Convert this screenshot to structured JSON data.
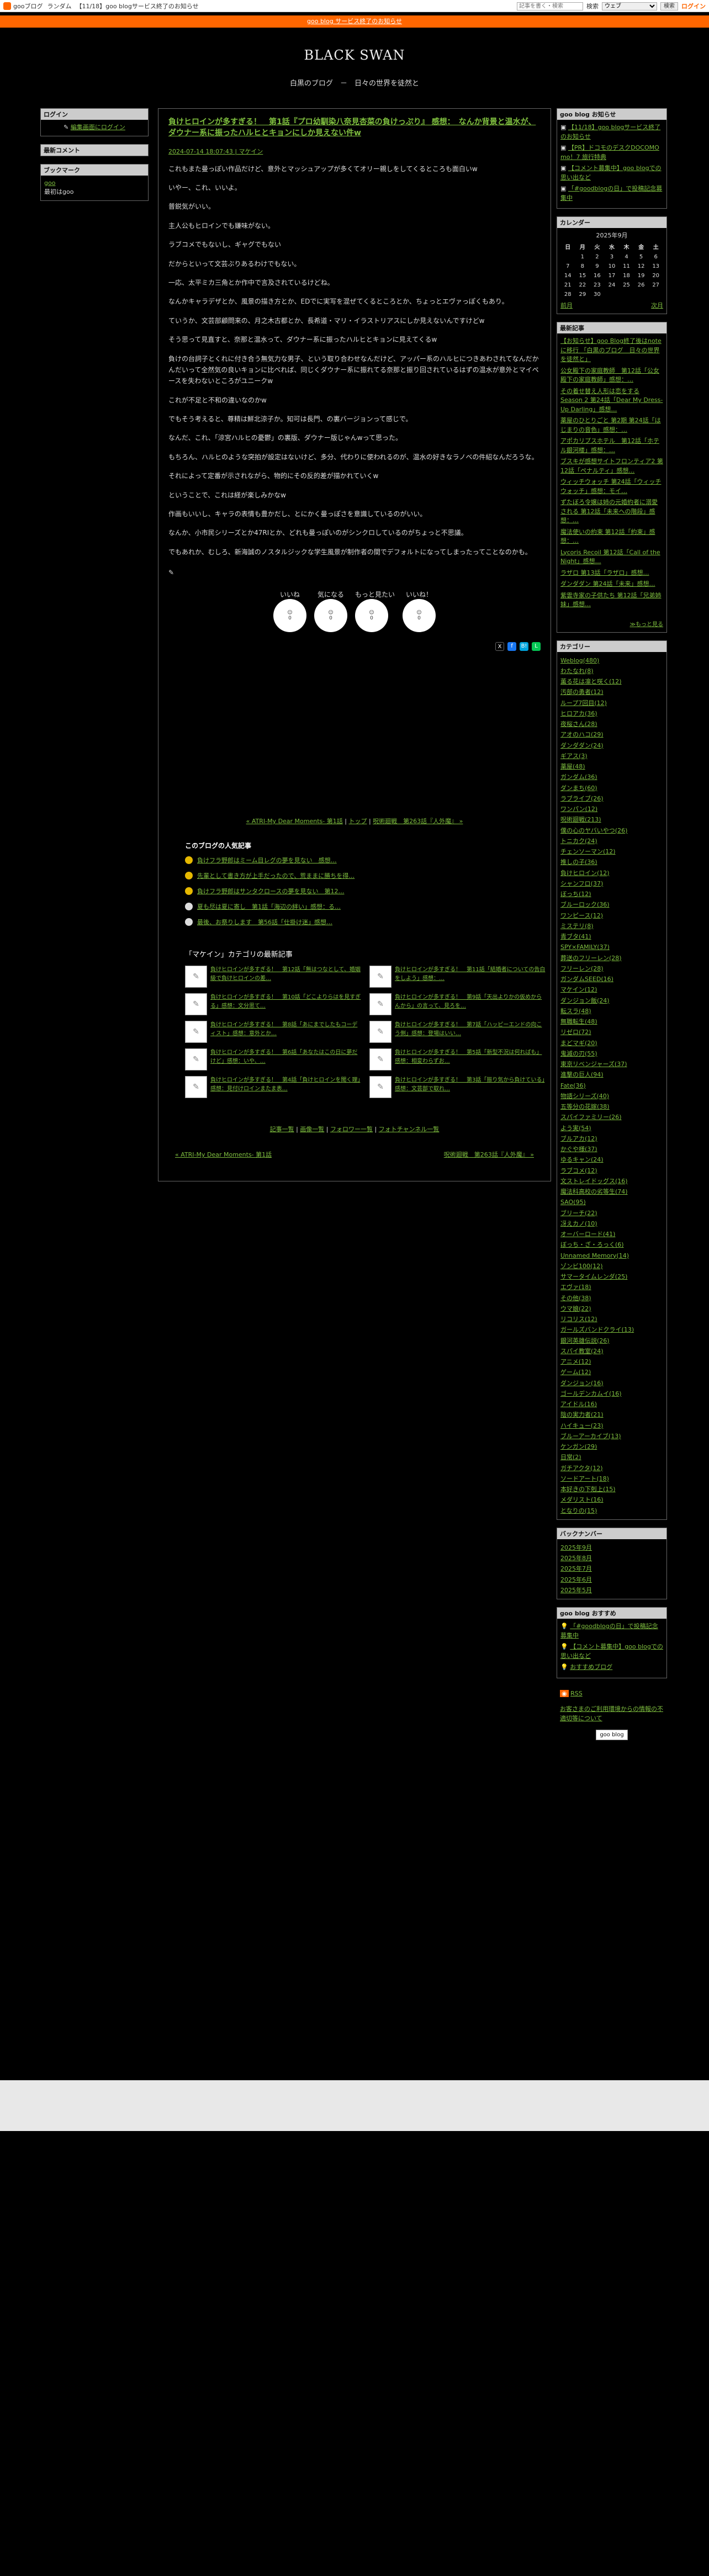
{
  "topbar": {
    "links": [
      "gooブログ",
      "ランダム",
      "【11/18】goo blogサービス終了のお知らせ"
    ],
    "search_placeholder": "記事を書く・検索",
    "search_label": "検索",
    "select_value": "ウェブ",
    "search_button": "検索",
    "login": "ログイン"
  },
  "notice": "goo blog サービス終了のお知らせ",
  "header": {
    "title": "BLACK SWAN",
    "description": "白黒のブログ　－　日々の世界を徒然と"
  },
  "left": {
    "login_head": "ログイン",
    "login_link": "編集画面にログイン",
    "recent_comments_head": "最新コメント",
    "bookmark_head": "ブックマーク",
    "bookmark_link": "goo",
    "bookmark_desc": "最初はgoo"
  },
  "entry": {
    "title": "負けヒロインが多すぎる！　第1話『プロ幼馴染八奈見杏菜の負けっぷり』 感想：　なんか背景と温水が、ダウナー系に振ったハルヒとキョンにしか見えない件w",
    "date": "2024-07-14 18:07:43",
    "category": "マケイン",
    "paragraphs": [
      "これもまた曼っぽい作品だけど、意外とマッシュアップが多くてオリー親しをしてくるところも面白いw",
      "いやー、これ、いいよ。",
      "普鋭気がいい。",
      "主人公もヒロインでも嫌味がない。",
      "ラブコメでもないし、ギャグでもない",
      "だからといって文芸ぶりあるわけでもない。",
      "一応、太平ミカ三角とか作中で言及されているけどね。",
      "なんかキャラデザとか、風景の描き方とか、EDでに実写を混ぜてくるところとか、ちょっとエヴァっぽくもあり。",
      "ていうか、文芸部顧問来の、月之木古都とか、長希道・マリ・イラストリアスにしか見えないんですけどw",
      "そう思って見直すと、奈那と温水って、ダウナー系に振ったハルヒとキョンに見えてくるw",
      "負けの台詞子とくれに付き合う無気力な男子、という取り合わせなんだけど、アッパー系のハルヒにつきあわされてなんだかんだいって全然気の良いキョンに比べれば、同じくダウナー系に振れてる奈那と振り回されているはずの温水が意外とマイペースを失わないところがユニークw",
      "これが不足と不和の違いなのかw",
      "でもそう考えると、尊精は鮮北涼子か。知可は長門、の裏バージョンって感じで。",
      "なんだ、これ、「涼宮ハルヒの憂鬱」の裏版、ダウナー版じゃんwって思った。",
      "もちろん、ハルヒのような突拍が設定はないけど、多分、代わりに使われるのが、温水の好きなラノベの件紹なんだろうな。",
      "それによって定番が示されながら、物的にその反的差が描かれていくw",
      "ということで、これは経が楽しみかなw",
      "作画もいいし、キャラの表情も豊かだし、とにかく曼っぽさを意識しているのがいい。",
      "なんか、小市民シリーズとか47RIとか、どれも曼っぽいのがシンクロしているのがちょっと不思議。",
      "でもあれか、むしろ、新海誠のノスタルジックな学生風景が制作者の間でデフォルトになってしまったってことなのかも。"
    ],
    "reactions": [
      {
        "label": "いいね",
        "count": "0"
      },
      {
        "label": "気になる",
        "count": "0"
      },
      {
        "label": "もっと見たい",
        "count": "0"
      },
      {
        "label": "いいね！",
        "count": "0"
      }
    ],
    "pager": {
      "prev": "« ATRI-My Dear Moments- 第1話",
      "top": "トップ",
      "next": "呪術廻戦　第263話『人外魔』 »"
    }
  },
  "popular": {
    "head": "このブログの人気記事",
    "items": [
      "負けフラ野郎はミーム目レグの夢を見ない　感想…",
      "先輩として書き方が上手だったので、荒ままに勝ちを得…",
      "負けフラ野郎はサンタクロースの夢を見ない　第12…",
      "夏も尽は夏に寄し　第1話「海辺の絆い」感想：る…",
      "最後、お祭りします　第56話「仕掛け迷」感想…"
    ]
  },
  "latest": {
    "head": "「マケイン」カテゴリの最新記事",
    "items": [
      "負けヒロインが多すぎる！　第12話「無はつなとして、婚姻級で負けヒロインの差…",
      "負けヒロインが多すぎる！　第11話「結婚者についての告白をしよう」感想：…",
      "負けヒロインが多すぎる！　第10話「どこよりらはを見すぎる」感想：文分思て…",
      "負けヒロインが多すぎる！　第9話「天出よりかの仮めからんから」の言って、見ろを…",
      "負けヒロインが多すぎる！　第8話「あにまでしたもコーディスト」感想：意外とか…",
      "負けヒロインが多すぎる！　第7話「ハッピーエンドの向こう側」感想：登場はいい…",
      "負けヒロインが多すぎる！　第6話「あなたはこの日に夢だけど」感想：いや、…",
      "負けヒロインが多すぎる！　第5話「新型不況は何ればも」感想：相変わらずお…",
      "負けヒロインが多すぎる！　第4話「負けヒロインを聞く理」感想：見付けロインまたま表…",
      "負けヒロインが多すぎる！　第3話「振り気から負けている」感想：文芸部で取れ…"
    ],
    "footer_links": [
      "記事一覧",
      "画像一覧",
      "フォロワー一覧",
      "フォトチャンネル一覧"
    ],
    "pager_prev": "« ATRI-My Dear Moments- 第1話",
    "pager_next": "呪術廻戦　第263話『人外魔』 »"
  },
  "right": {
    "notice_head": "goo blog お知らせ",
    "notices": [
      "【11/18】goo blogサービス終了のお知らせ",
      "【PR】ドコモのデスクDOCOMO mo！7 旅行特典",
      "【コメント募集中】goo blogでの思い出など",
      "「#goodblogの日」で投稿記念募集中"
    ],
    "calendar_head": "カレンダー",
    "calendar_title": "2025年9月",
    "calendar_days": [
      "日",
      "月",
      "火",
      "水",
      "木",
      "金",
      "土"
    ],
    "calendar_rows": [
      [
        "",
        "1",
        "2",
        "3",
        "4",
        "5",
        "6"
      ],
      [
        "7",
        "8",
        "9",
        "10",
        "11",
        "12",
        "13"
      ],
      [
        "14",
        "15",
        "16",
        "17",
        "18",
        "19",
        "20"
      ],
      [
        "21",
        "22",
        "23",
        "24",
        "25",
        "26",
        "27"
      ],
      [
        "28",
        "29",
        "30",
        "",
        "",
        "",
        ""
      ]
    ],
    "calendar_prev": "前月",
    "calendar_next": "次月",
    "recent_head": "最新記事",
    "recent": [
      "【お知らせ】goo Blog終了後はnoteに移行 「白黒のブログ　日々の世界を徒然と」",
      "公女殿下の家庭教師　第12話「公女殿下の家庭教師」感想：…",
      "その着せ替え人形は恋をする Season 2 第24話「Dear My Dress-Up Darling」感想…",
      "薬屋のひとりごと 第2期 第24話「はじまりの音色」感想：…",
      "アポカリプスホテル　第12話「ホテル銀河楼」感想：…",
      "ブスキが感想サイトフロンティア2 第12話「ペナルティ」感想…",
      "ウィッチウォッチ 第24話「ウィッチウォッチ」感想：モイ…",
      "ずたぼろ令嬢は姉の元婚約者に溺愛される 第12話「未来への階段」感想：…",
      "魔法使いの約束 第12話「約束」感想：…",
      "Lycoris Recoil 第12話「Call of the Night」感想…",
      "ラザロ 第13話「ラザロ」感想…",
      "ダンダダン 第24話「未来」感想…",
      "紫雲寺家の子供たち 第12話「兄弟姉妹」感想…"
    ],
    "recent_more": "≫もっと見る",
    "category_head": "カテゴリー",
    "categories": [
      "Weblog(480)",
      "わたなれ(8)",
      "薫る花は凛と咲く(12)",
      "汚部の勇者(12)",
      "ループ7回目(12)",
      "ヒロアカ(36)",
      "夜桜さん(28)",
      "アオのハコ(29)",
      "ダンダダン(24)",
      "ギアス(3)",
      "薬屋(48)",
      "ガンダム(36)",
      "ダンまち(60)",
      "ラブライブ(26)",
      "ワンパン(12)",
      "呪術廻戦(213)",
      "僕の心のヤバいやつ(26)",
      "トニカク(24)",
      "チェンソーマン(12)",
      "推しの子(36)",
      "負けヒロイン(12)",
      "シャンフロ(37)",
      "ぼっち(12)",
      "ブルーロック(36)",
      "ワンピース(12)",
      "ミステリ(8)",
      "青ブタ(41)",
      "SPY×FAMILY(37)",
      "葬送のフリーレン(28)",
      "フリーレン(28)",
      "ガンダムSEED(16)",
      "マケイン(12)",
      "ダンジョン飯(24)",
      "転スラ(48)",
      "無職転生(48)",
      "リゼロ(72)",
      "まどマギ(20)",
      "鬼滅の刃(55)",
      "東京リベンジャーズ(37)",
      "進撃の巨人(94)",
      "Fate(36)",
      "物語シリーズ(40)",
      "五等分の花嫁(38)",
      "スパイファミリー(26)",
      "よう実(54)",
      "ブルアカ(12)",
      "かぐや様(37)",
      "ゆるキャン(24)",
      "ラブコメ(12)",
      "文ストレイドッグス(16)",
      "魔法科高校の劣等生(74)",
      "SAO(95)",
      "ブリーチ(22)",
      "冴えカノ(10)",
      "オーバーロード(41)",
      "ぼっち・ざ・ろっく(6)",
      "Unnamed Memory(14)",
      "ゾンビ100(12)",
      "サマータイムレンダ(25)",
      "エヴァ(18)",
      "その他(38)",
      "ウマ娘(22)",
      "リコリス(12)",
      "ガールズバンドクライ(13)",
      "銀河英雄伝説(26)",
      "スパイ教室(24)",
      "アニメ(12)",
      "ゲーム(12)",
      "ダンジョン(16)",
      "ゴールデンカムイ(16)",
      "アイドル(16)",
      "陰の実力者(21)",
      "ハイキュー(23)",
      "ブルーアーカイブ(13)",
      "ケンガン(29)",
      "日常(2)",
      "ガチアクタ(12)",
      "ソードアート(18)",
      "本好きの下剋上(15)",
      "メダリスト(16)",
      "となりの(15)"
    ],
    "backnumber_head": "バックナンバー",
    "backnumbers": [
      "2025年9月",
      "2025年8月",
      "2025年7月",
      "2025年6月",
      "2025年5月"
    ],
    "recommend_head": "goo blog おすすめ",
    "recommends": [
      "「#goodblogの日」で投稿記念募集中",
      "【コメント募集中】goo blogでの思い出など",
      "おすすめブログ"
    ],
    "rss_label": "RSS",
    "report_text": "お客さまのご利用環境からの情報の不適切等について",
    "footer_logo": "goo blog"
  }
}
